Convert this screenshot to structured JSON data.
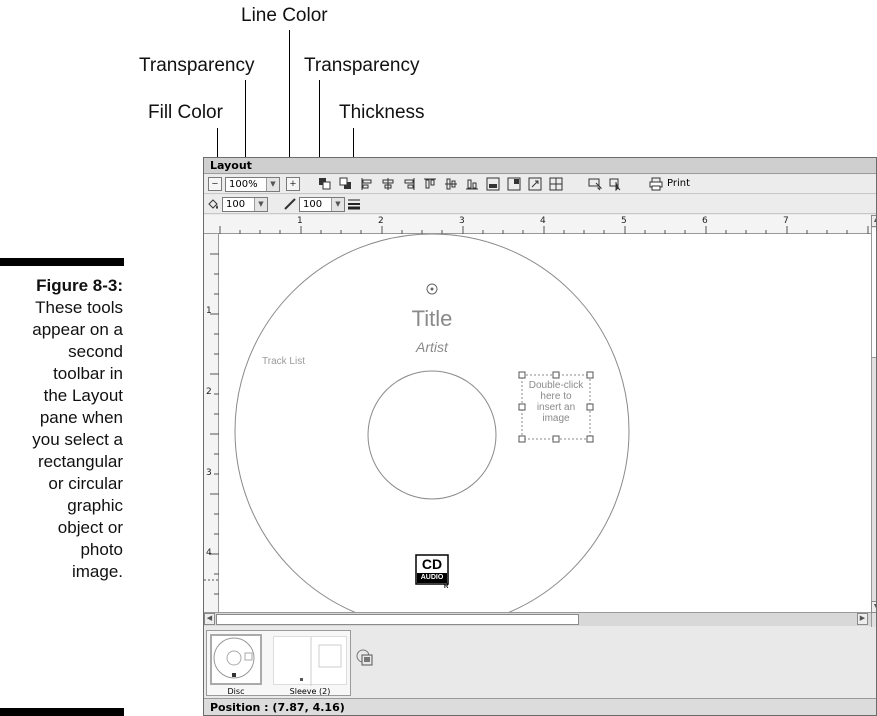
{
  "callouts": {
    "line_color": "Line Color",
    "transparency_left": "Transparency",
    "transparency_right": "Transparency",
    "fill_color": "Fill Color",
    "thickness": "Thickness"
  },
  "caption": {
    "label": "Figure 8-3:",
    "lines": [
      "These tools",
      "appear on a",
      "second",
      "toolbar in",
      "the Layout",
      "pane when",
      "you select a",
      "rectangular",
      "or circular",
      "graphic",
      "object or",
      "photo",
      "image."
    ]
  },
  "window": {
    "title": "Layout",
    "toolbar": {
      "zoom_value": "100%",
      "zoom_out_icon": "minus-icon",
      "zoom_in_icon": "plus-icon",
      "print_label": "Print"
    },
    "toolbar2": {
      "fill_transparency": "100",
      "line_transparency": "100"
    },
    "ruler": {
      "h_labels": [
        "1",
        "2",
        "3",
        "4",
        "5",
        "6",
        "7"
      ],
      "v_labels": [
        "1",
        "2",
        "3",
        "4"
      ]
    },
    "disc": {
      "title": "Title",
      "artist": "Artist",
      "track_list": "Track List",
      "image_placeholder": [
        "Double-click",
        "here to",
        "insert an",
        "image"
      ],
      "logo_top": "CD",
      "logo_bottom": "AUDIO",
      "logo_mark": "R"
    },
    "thumbnails": [
      {
        "label": "Disc"
      },
      {
        "label": "Sleeve (2)"
      }
    ],
    "status": "Position : (7.87, 4.16)"
  }
}
